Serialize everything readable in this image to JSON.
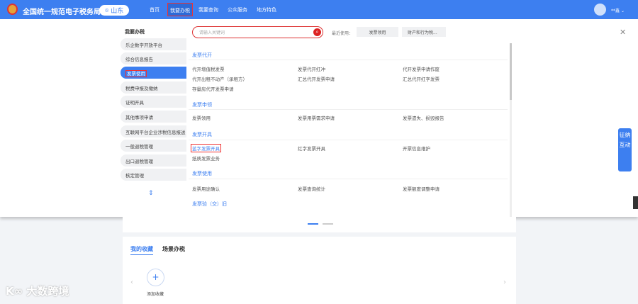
{
  "header": {
    "title": "全国统一规范电子税务局",
    "province": "山东",
    "nav": [
      "首页",
      "我要办税",
      "我要查询",
      "公众服务",
      "地方特色"
    ],
    "active_nav": "我要办税",
    "user": "**鑫"
  },
  "sidebar": {
    "title": "我要办税",
    "items": [
      "乐企数字开放平台",
      "综合信息报告",
      "发票使用",
      "税费申报及缴纳",
      "证明开具",
      "其他事项申请",
      "互联网平台企业涉税信息报送",
      "一般退税管理",
      "出口退税管理",
      "核定管理"
    ],
    "selected": "发票使用"
  },
  "search": {
    "placeholder": "请输入关键词",
    "recent_label": "最近使用：",
    "recent": [
      "发票领用",
      "财产和行为税..."
    ]
  },
  "sections": [
    {
      "title": "发票代开",
      "items": [
        "代开增值税发票",
        "发票代开红冲",
        "代开发票申请作废",
        "代开出租不动产（承租方）",
        "汇总代开发票申请",
        "汇总代开红字发票",
        "存量房代开发票申请"
      ]
    },
    {
      "title": "发票申领",
      "items": [
        "发票领用",
        "发票用票需求申请",
        "发票遗失、损毁报告"
      ]
    },
    {
      "title": "发票开具",
      "items": [
        "蓝字发票开具",
        "红字发票开具",
        "开票信息维护",
        "纸质发票业务"
      ],
      "highlighted": "蓝字发票开具"
    },
    {
      "title": "发票使用",
      "items": [
        "发票用途确认",
        "发票查询统计",
        "发票额度调整申请"
      ]
    },
    {
      "title": "发票验（交）旧",
      "items": []
    }
  ],
  "float_button": "征纳互动",
  "bottom": {
    "tabs": [
      "我的收藏",
      "场景办税"
    ],
    "active_tab": "我的收藏",
    "add_label": "添加收藏"
  },
  "watermark": "大数跨境",
  "colors": {
    "primary": "#3d7ff0",
    "highlight": "#e33333"
  }
}
